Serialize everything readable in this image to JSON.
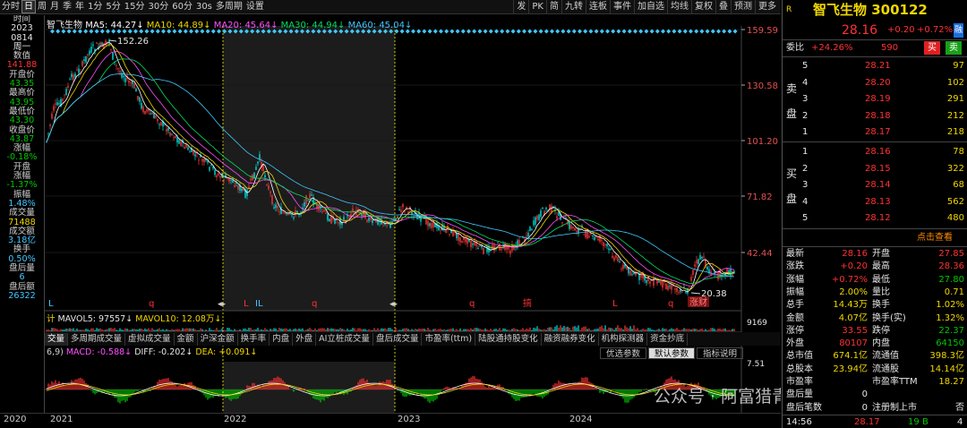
{
  "toolbar": {
    "left": [
      "分时",
      "日",
      "周",
      "月",
      "季",
      "年",
      "1分",
      "5分",
      "15分",
      "30分",
      "60分",
      "30s",
      "多周期",
      "设置"
    ],
    "active_index": 1,
    "right": [
      "发",
      "PK",
      "简",
      "九转",
      "连板",
      "事件",
      "加自选",
      "均线",
      "复权",
      "叠",
      "预测",
      "更多"
    ]
  },
  "left_panel": [
    {
      "t": "时间",
      "c": "lab"
    },
    {
      "t": "2023",
      "c": "white"
    },
    {
      "t": "0814",
      "c": "white"
    },
    {
      "t": "周一",
      "c": "white"
    },
    {
      "t": "数值",
      "c": "lab"
    },
    {
      "t": "141.88",
      "c": "red"
    },
    {
      "t": "开盘价",
      "c": "lab"
    },
    {
      "t": "43.35",
      "c": "green"
    },
    {
      "t": "最高价",
      "c": "lab"
    },
    {
      "t": "43.95",
      "c": "green"
    },
    {
      "t": "最低价",
      "c": "lab"
    },
    {
      "t": "43.30",
      "c": "green"
    },
    {
      "t": "收盘价",
      "c": "lab"
    },
    {
      "t": "43.87",
      "c": "green"
    },
    {
      "t": "涨幅",
      "c": "lab"
    },
    {
      "t": "-0.18%",
      "c": "green"
    },
    {
      "t": "开盘",
      "c": "lab"
    },
    {
      "t": "涨幅",
      "c": "lab"
    },
    {
      "t": "-1.37%",
      "c": "green"
    },
    {
      "t": "振幅",
      "c": "lab"
    },
    {
      "t": "1.48%",
      "c": "cyan"
    },
    {
      "t": "成交量",
      "c": "lab"
    },
    {
      "t": "71488",
      "c": "yellow"
    },
    {
      "t": "成交额",
      "c": "lab"
    },
    {
      "t": "3.18亿",
      "c": "cyan"
    },
    {
      "t": "换手",
      "c": "lab"
    },
    {
      "t": "0.50%",
      "c": "cyan"
    },
    {
      "t": "盘后量",
      "c": "lab"
    },
    {
      "t": "6",
      "c": "cyan"
    },
    {
      "t": "盘后额",
      "c": "lab"
    },
    {
      "t": "26322",
      "c": "cyan"
    }
  ],
  "ma_legend": {
    "name": "智飞生物",
    "ma5": "MA5: 44.27↓",
    "ma10": "MA10: 44.89↓",
    "ma20": "MA20: 45.64↓",
    "ma30": "MA30: 44.94↓",
    "ma60": "MA60: 45.04↓"
  },
  "price_axis": [
    "159.59",
    "130.58",
    "101.20",
    "71.82",
    "42.44"
  ],
  "annotations": {
    "high": "152.26",
    "low": "20.38",
    "tag_low": "涨财"
  },
  "markers": [
    {
      "t": "L"
    },
    {
      "t": "q"
    },
    {
      "t": "L"
    },
    {
      "t": "IL"
    },
    {
      "t": "q"
    },
    {
      "t": "q"
    },
    {
      "t": "搞"
    },
    {
      "t": "L"
    },
    {
      "t": "q"
    }
  ],
  "volume_line": {
    "prefix": "计",
    "mavol5": "MAVOL5: 97557↓",
    "mavol10": "MAVOL10: 12.08万↓",
    "axis_top": "9169"
  },
  "indicator_tabs": [
    "交量",
    "多周期成交量",
    "虚拟成交量",
    "金额",
    "沪深金额",
    "换手率",
    "内盘",
    "外盘",
    "AI立桩成交量",
    "盘后成交量",
    "市盈率(ttm)",
    "陆股通持股变化",
    "融资融券变化",
    "机构探测器",
    "资金抄底"
  ],
  "indicator_selected": 0,
  "macd_line": {
    "param": "6,9)",
    "macd": "MACD: -0.588↓",
    "diff": "DIFF: -0.202↓",
    "dea": "DEA: +0.091↓"
  },
  "macd_axis_top": "7.51",
  "opts": [
    "优选参数",
    "默认参数",
    "指标说明"
  ],
  "opts_selected": 1,
  "years": [
    "2020",
    "2021",
    "2022",
    "2023",
    "2024"
  ],
  "watermark": "公众号 · 阿富猎青",
  "rp": {
    "code_tag": "R",
    "title": "智飞生物 300122",
    "price": "28.16",
    "chg": "+0.20",
    "pct": "+0.72%",
    "flag": "融",
    "wb_label": "委比",
    "wb": "+24.26%",
    "wc": "590",
    "buy_btn": "买",
    "sell_btn": "卖",
    "sell_label": [
      "卖",
      "盘"
    ],
    "buy_label": [
      "买",
      "盘"
    ],
    "sells": [
      {
        "n": "5",
        "p": "28.21",
        "v": "97"
      },
      {
        "n": "4",
        "p": "28.20",
        "v": "102"
      },
      {
        "n": "3",
        "p": "28.19",
        "v": "291"
      },
      {
        "n": "2",
        "p": "28.18",
        "v": "212"
      },
      {
        "n": "1",
        "p": "28.17",
        "v": "218"
      }
    ],
    "buys": [
      {
        "n": "1",
        "p": "28.16",
        "v": "78"
      },
      {
        "n": "2",
        "p": "28.15",
        "v": "322"
      },
      {
        "n": "3",
        "p": "28.14",
        "v": "68"
      },
      {
        "n": "4",
        "p": "28.13",
        "v": "562"
      },
      {
        "n": "5",
        "p": "28.12",
        "v": "480"
      }
    ],
    "dianji": "点击查看",
    "stats": [
      [
        "最新",
        "28.16",
        "red",
        "开盘",
        "27.85",
        "red"
      ],
      [
        "涨跌",
        "+0.20",
        "red",
        "最高",
        "28.36",
        "red"
      ],
      [
        "涨幅",
        "+0.72%",
        "red",
        "最低",
        "27.80",
        "green"
      ],
      [
        "振幅",
        "2.00%",
        "yellow",
        "量比",
        "0.71",
        "yellow"
      ],
      [
        "总手",
        "14.43万",
        "yellow",
        "换手",
        "1.02%",
        "yellow"
      ],
      [
        "金额",
        "4.07亿",
        "yellow",
        "换手(实)",
        "1.32%",
        "yellow"
      ],
      [
        "涨停",
        "33.55",
        "red",
        "跌停",
        "22.37",
        "green"
      ],
      [
        "外盘",
        "80107",
        "red",
        "内盘",
        "64150",
        "green"
      ],
      [
        "总市值",
        "674.1亿",
        "yellow",
        "流通值",
        "398.3亿",
        "yellow"
      ],
      [
        "总股本",
        "23.94亿",
        "yellow",
        "流通股",
        "14.14亿",
        "yellow"
      ],
      [
        "市盈率",
        "",
        "white",
        "市盈率TTM",
        "18.27",
        "yellow"
      ],
      [
        "盘后量",
        "0",
        "white",
        "",
        "",
        "white"
      ],
      [
        "盘后笔数",
        "0",
        "white",
        "注册制上市",
        "否",
        "white"
      ]
    ],
    "tick": {
      "time": "14:56",
      "price": "28.17",
      "vol": "19",
      "dir": "B",
      "n": "4"
    }
  }
}
